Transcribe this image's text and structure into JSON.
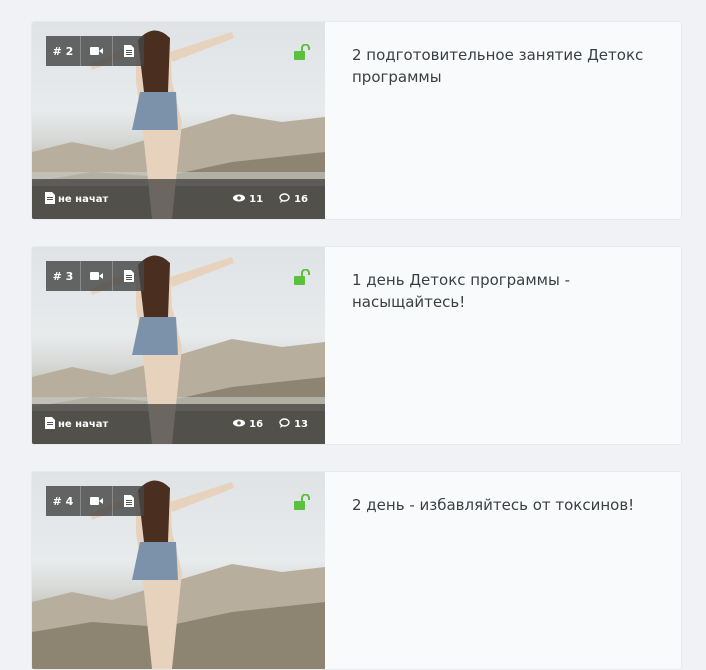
{
  "lessons": [
    {
      "number": "# 2",
      "title": "2 подготовительное занятие Детокс программы",
      "status": "не начат",
      "views": "11",
      "comments": "16",
      "icons": [
        "video-icon",
        "document-icon",
        "unlock-icon",
        "eye-icon",
        "comment-icon"
      ]
    },
    {
      "number": "# 3",
      "title": "1 день Детокс программы - насыщайтесь!",
      "status": "не начат",
      "views": "16",
      "comments": "13",
      "icons": [
        "video-icon",
        "document-icon",
        "unlock-icon",
        "eye-icon",
        "comment-icon"
      ]
    },
    {
      "number": "# 4",
      "title": "2 день - избавляйтесь от токсинов!",
      "icons": [
        "video-icon",
        "document-icon",
        "unlock-icon"
      ]
    }
  ],
  "colors": {
    "unlock": "#5cbf3e",
    "title": "#3a3f44",
    "card_bg": "#f9fafb",
    "page_bg": "#f1f2f5"
  }
}
